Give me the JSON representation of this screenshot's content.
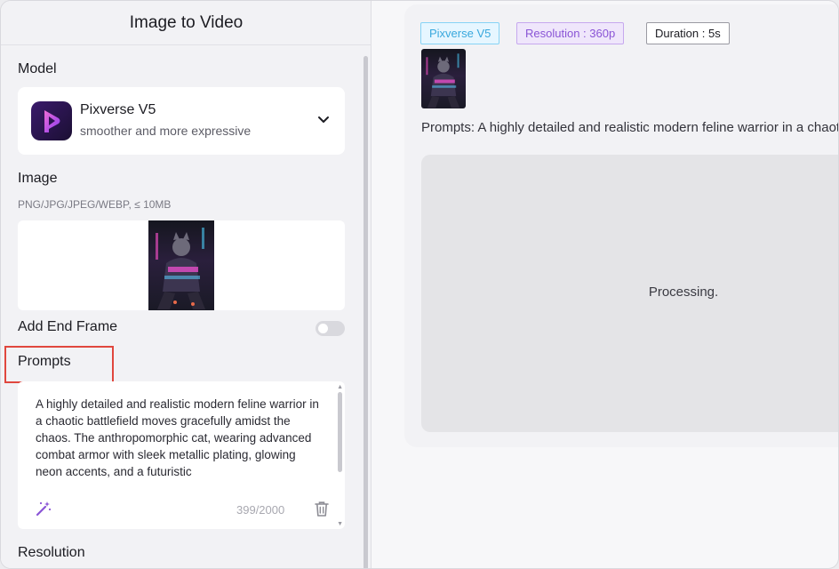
{
  "left_panel": {
    "title": "Image to Video",
    "model": {
      "label": "Model",
      "name": "Pixverse V5",
      "description": "smoother and more expressive",
      "logo_icon": "pixverse-logo-icon",
      "chevron_icon": "chevron-down-icon"
    },
    "image": {
      "label": "Image",
      "hint": "PNG/JPG/JPEG/WEBP, ≤ 10MB"
    },
    "end_frame": {
      "label": "Add End Frame",
      "enabled": false
    },
    "prompts": {
      "label": "Prompts",
      "text": "A highly detailed and realistic modern feline warrior in a chaotic battlefield moves gracefully amidst the chaos. The anthropomorphic cat, wearing advanced combat armor with sleek metallic plating, glowing neon accents, and a futuristic",
      "counter": "399/2000",
      "magic_icon": "magic-wand-icon",
      "trash_icon": "trash-icon"
    },
    "resolution": {
      "label": "Resolution"
    }
  },
  "result": {
    "tags": {
      "model": "Pixverse V5",
      "resolution": "Resolution : 360p",
      "duration": "Duration : 5s"
    },
    "prompt_line": "Prompts: A highly detailed and realistic modern feline warrior in a chaotic battlefield moves gracefully amidst the chaos.",
    "status": "Processing."
  },
  "colors": {
    "highlight_border": "#e0473e",
    "tag_model": "#39a8dd",
    "tag_resolution": "#8a54d6",
    "magic_icon": "#8a54d6"
  }
}
